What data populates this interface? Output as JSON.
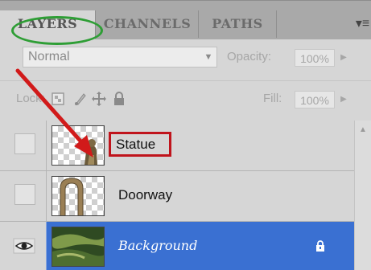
{
  "tabs": [
    {
      "label": "LAYERS",
      "active": true
    },
    {
      "label": "CHANNELS",
      "active": false
    },
    {
      "label": "PATHS",
      "active": false
    }
  ],
  "panel_menu_icon": "panel-menu-icon",
  "blend_mode": {
    "value": "Normal"
  },
  "opacity": {
    "label": "Opacity:",
    "value": "100%"
  },
  "lock": {
    "label": "Lock:",
    "icons": [
      "lock-transparent-icon",
      "lock-image-icon",
      "lock-position-icon",
      "lock-all-icon"
    ]
  },
  "fill": {
    "label": "Fill:",
    "value": "100%"
  },
  "layers": [
    {
      "name": "Statue",
      "visible": false,
      "selected": false
    },
    {
      "name": "Doorway",
      "visible": false,
      "selected": false
    },
    {
      "name": "Background",
      "visible": true,
      "selected": true,
      "locked": true
    }
  ],
  "colors": {
    "selected_row": "#3a70d2",
    "annotation_circle": "#2e9e35",
    "annotation_arrow": "#d11a1a",
    "annotation_box": "#c0141c"
  }
}
